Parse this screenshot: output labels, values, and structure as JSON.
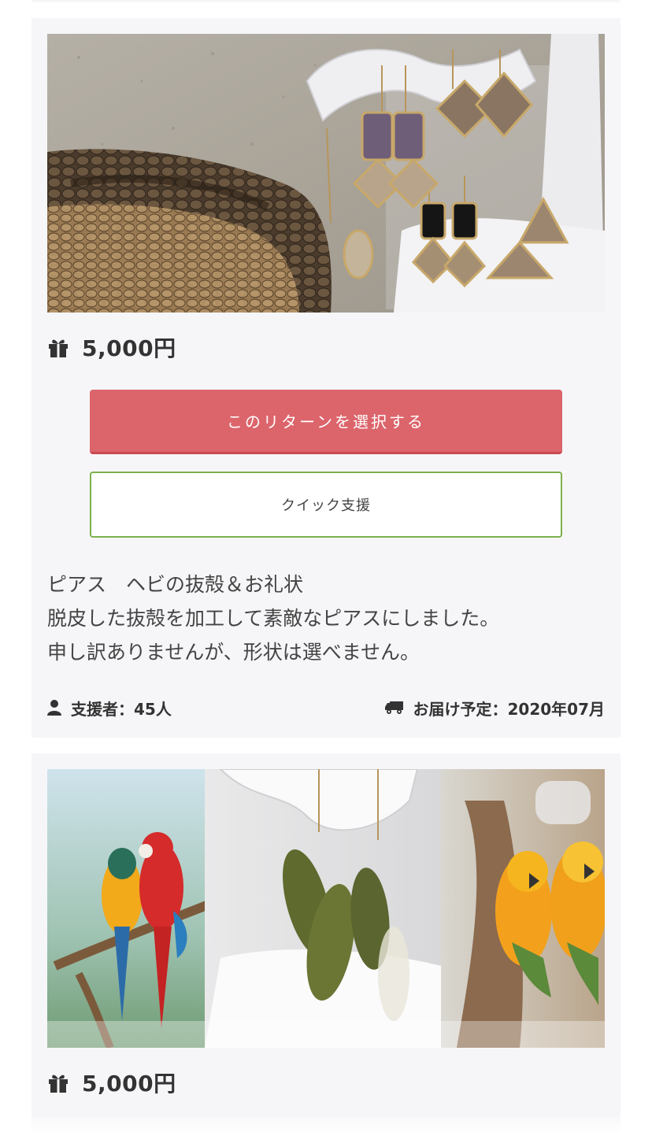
{
  "rewards": [
    {
      "image_alt": "snake-skin earrings beside a ball python",
      "price": "5,000円",
      "select_button": "このリターンを選択する",
      "quick_button": "クイック支援",
      "description": [
        "ピアス　ヘビの抜殻＆お礼状",
        "脱皮した抜殻を加工して素敵なピアスにしました。",
        "申し訳ありませんが、形状は選べません。"
      ],
      "supporters": "支援者：45人",
      "delivery": "お届け予定：2020年07月"
    },
    {
      "image_alt": "feather earrings with parrots",
      "price": "5,000円"
    }
  ],
  "icons": {
    "gift": "gift-icon",
    "user": "user-icon",
    "truck": "truck-icon"
  },
  "colors": {
    "card_bg": "#f6f6f9",
    "select_button": "#dc646b",
    "quick_border": "#7db04c",
    "text": "#333333"
  }
}
